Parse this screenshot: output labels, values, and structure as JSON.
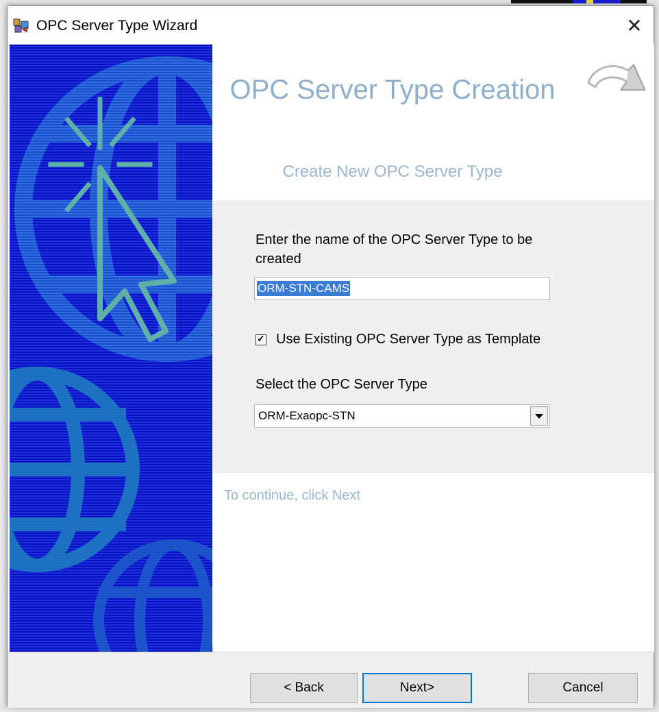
{
  "window": {
    "title": "OPC Server Type Wizard",
    "close_glyph": "✕"
  },
  "header": {
    "title": "OPC Server Type Creation",
    "subtitle": "Create New OPC Server Type"
  },
  "form": {
    "name_prompt": "Enter the name of the OPC Server Type to be created",
    "name_value": "ORM-STN-CAMS",
    "use_template_label": "Use Existing OPC Server Type as Template",
    "use_template_checked": true,
    "select_label": "Select the OPC Server Type",
    "selected_server_type": "ORM-Exaopc-STN"
  },
  "footer": {
    "continue_text": "To continue, click Next"
  },
  "buttons": {
    "back": "< Back",
    "next": "Next>",
    "cancel": "Cancel"
  },
  "colors": {
    "side_panel_blue": "#0a10c8",
    "globe_blue": "#2b5fd6",
    "cursor_teal": "#4fa8a0",
    "header_text": "#8fb0cc",
    "selection_blue": "#3a7bd5",
    "default_button_border": "#0078d7"
  },
  "icons": {
    "title_icon": "wizard-app-icon",
    "header_icon": "curved-arrow-icon",
    "side_art": "globe-cursor-illustration",
    "dropdown": "dropdown-arrow-icon"
  }
}
